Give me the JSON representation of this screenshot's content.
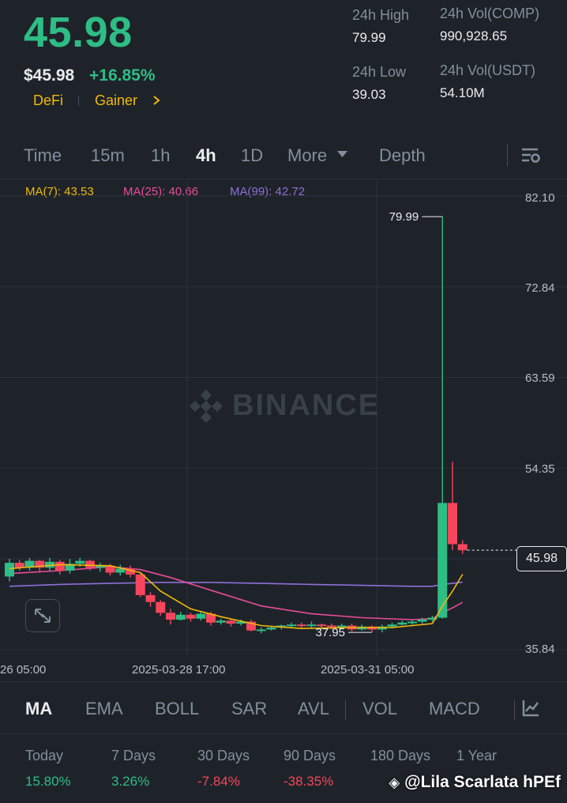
{
  "header": {
    "last_price": "45.98",
    "usd_price": "$45.98",
    "change": "+16.85%",
    "tags": [
      "DeFi",
      "Gainer"
    ]
  },
  "stats": {
    "high_label": "24h High",
    "high_value": "79.99",
    "low_label": "24h Low",
    "low_value": "39.03",
    "vol_comp_label": "24h Vol(COMP)",
    "vol_comp_value": "990,928.65",
    "vol_usdt_label": "24h Vol(USDT)",
    "vol_usdt_value": "54.10M"
  },
  "interval_tabs": {
    "time": "Time",
    "m15": "15m",
    "h1": "1h",
    "h4": "4h",
    "d1": "1D",
    "more": "More",
    "depth": "Depth",
    "active": "4h"
  },
  "ma_legend": {
    "ma7": "MA(7): 43.53",
    "ma25": "MA(25): 40.66",
    "ma99": "MA(99): 42.72"
  },
  "colors": {
    "up": "#2ebd85",
    "down": "#f6465d",
    "ma7": "#f0b90b",
    "ma25": "#e84c9a",
    "ma99": "#8e6fd8",
    "grid": "#2b3139"
  },
  "watermark": "BINANCE",
  "chart_data": {
    "type": "candlestick",
    "y_axis_ticks": [
      "82.10",
      "72.84",
      "63.59",
      "54.35",
      "45.98",
      "35.84"
    ],
    "ylim": [
      35.84,
      82.1
    ],
    "x_axis_ticks": [
      "26 05:00",
      "2025-03-28 17:00",
      "2025-03-31 05:00"
    ],
    "current_price": "45.98",
    "annotations": {
      "high": "79.99",
      "low": "37.95"
    },
    "candles": [
      [
        43.3,
        44.7,
        42.8,
        45.1
      ],
      [
        44.7,
        44.2,
        43.9,
        45.0
      ],
      [
        44.2,
        44.9,
        43.9,
        45.2
      ],
      [
        44.9,
        44.2,
        43.8,
        45.0
      ],
      [
        44.2,
        44.8,
        43.9,
        45.2
      ],
      [
        44.8,
        43.9,
        43.5,
        45.0
      ],
      [
        43.9,
        44.6,
        43.6,
        45.1
      ],
      [
        44.6,
        44.9,
        44.3,
        45.2
      ],
      [
        44.9,
        44.2,
        43.9,
        45.0
      ],
      [
        44.2,
        44.4,
        43.8,
        44.7
      ],
      [
        44.4,
        43.7,
        43.4,
        44.6
      ],
      [
        43.7,
        44.1,
        43.4,
        44.5
      ],
      [
        44.1,
        43.5,
        43.2,
        44.4
      ],
      [
        43.5,
        41.4,
        41.2,
        43.7
      ],
      [
        41.4,
        40.7,
        40.2,
        41.7
      ],
      [
        40.7,
        39.6,
        39.3,
        40.9
      ],
      [
        39.6,
        38.9,
        38.4,
        40.0
      ],
      [
        38.9,
        39.4,
        38.8,
        39.7
      ],
      [
        39.4,
        39.0,
        38.7,
        39.6
      ],
      [
        39.0,
        39.5,
        38.8,
        39.8
      ],
      [
        39.5,
        38.6,
        38.3,
        39.7
      ],
      [
        38.6,
        38.8,
        38.4,
        39.0
      ],
      [
        38.8,
        38.5,
        38.2,
        39.0
      ],
      [
        38.5,
        38.7,
        38.3,
        38.9
      ],
      [
        38.7,
        37.8,
        37.7,
        38.9
      ],
      [
        37.8,
        37.9,
        37.5,
        38.1
      ],
      [
        37.9,
        38.1,
        37.8,
        38.2
      ],
      [
        38.1,
        38.3,
        37.9,
        38.4
      ],
      [
        38.3,
        38.4,
        38.1,
        38.6
      ],
      [
        38.4,
        38.3,
        38.0,
        38.6
      ],
      [
        38.3,
        38.4,
        38.0,
        38.7
      ],
      [
        38.4,
        38.3,
        38.0,
        38.5
      ],
      [
        38.3,
        38.2,
        37.9,
        38.5
      ],
      [
        38.2,
        38.3,
        38.0,
        38.5
      ],
      [
        38.3,
        37.9,
        37.7,
        38.5
      ],
      [
        37.9,
        38.2,
        37.8,
        38.4
      ],
      [
        38.2,
        37.9,
        37.6,
        38.3
      ],
      [
        37.9,
        38.2,
        37.6,
        38.4
      ],
      [
        38.2,
        38.4,
        38.0,
        38.6
      ],
      [
        38.4,
        38.6,
        38.3,
        38.8
      ],
      [
        38.6,
        38.7,
        38.4,
        38.9
      ],
      [
        38.7,
        38.9,
        38.5,
        39.1
      ],
      [
        38.9,
        39.1,
        38.7,
        39.3
      ],
      [
        39.1,
        50.8,
        39.0,
        79.99
      ],
      [
        50.8,
        46.6,
        46.0,
        55.0
      ],
      [
        46.6,
        45.98,
        45.6,
        47.0
      ]
    ],
    "ma7": [
      [
        0,
        44.1
      ],
      [
        5,
        44.5
      ],
      [
        10,
        44.4
      ],
      [
        13,
        43.7
      ],
      [
        15,
        41.8
      ],
      [
        18,
        40.0
      ],
      [
        21,
        39.2
      ],
      [
        25,
        38.3
      ],
      [
        29,
        38.0
      ],
      [
        34,
        38.1
      ],
      [
        38,
        38.1
      ],
      [
        42,
        38.5
      ],
      [
        43,
        40.3
      ],
      [
        44,
        41.8
      ],
      [
        45,
        43.53
      ]
    ],
    "ma25": [
      [
        0,
        43.6
      ],
      [
        5,
        43.9
      ],
      [
        10,
        44.3
      ],
      [
        13,
        44.0
      ],
      [
        16,
        43.2
      ],
      [
        20,
        41.9
      ],
      [
        25,
        40.3
      ],
      [
        30,
        39.5
      ],
      [
        35,
        39.1
      ],
      [
        40,
        38.9
      ],
      [
        42,
        39.0
      ],
      [
        43,
        39.6
      ],
      [
        44,
        40.1
      ],
      [
        45,
        40.66
      ]
    ],
    "ma99": [
      [
        0,
        42.3
      ],
      [
        5,
        42.5
      ],
      [
        10,
        42.6
      ],
      [
        15,
        42.7
      ],
      [
        20,
        42.7
      ],
      [
        25,
        42.6
      ],
      [
        30,
        42.5
      ],
      [
        35,
        42.4
      ],
      [
        40,
        42.3
      ],
      [
        42,
        42.3
      ],
      [
        43,
        42.5
      ],
      [
        44,
        42.6
      ],
      [
        45,
        42.72
      ]
    ]
  },
  "indicator_tabs": [
    "MA",
    "EMA",
    "BOLL",
    "SAR",
    "AVL",
    "VOL",
    "MACD"
  ],
  "performance": {
    "labels": [
      "Today",
      "7 Days",
      "30 Days",
      "90 Days",
      "180 Days",
      "1 Year"
    ],
    "values": [
      "15.80%",
      "3.26%",
      "-7.84%",
      "-38.35%"
    ]
  },
  "credit": "@Lila Scarlata hPEf"
}
